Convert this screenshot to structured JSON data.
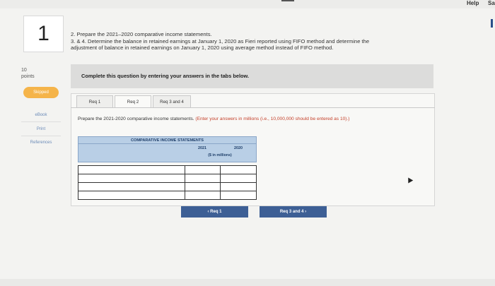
{
  "header": {
    "help": "Help",
    "save": "Sa"
  },
  "question": {
    "number": "1",
    "points_value": "10",
    "points_label": "points",
    "status": "Skipped"
  },
  "sidebar": {
    "links": [
      "eBook",
      "Print",
      "References"
    ]
  },
  "prompt": {
    "line1": "2. Prepare the 2021–2020 comparative income statements.",
    "line2": "3. & 4. Determine the balance in retained earnings at January 1, 2020 as Fieri reported using FIFO method and determine the",
    "line3": "adjustment of balance in retained earnings on January 1, 2020 using average method instead of FIFO method."
  },
  "banner": {
    "text": "Complete this question by entering your answers in the tabs below."
  },
  "tabs": [
    {
      "label": "Req 1"
    },
    {
      "label": "Req 2"
    },
    {
      "label": "Req 3 and 4"
    }
  ],
  "instruction": {
    "text": "Prepare the 2021-2020 comparative income statements.",
    "note": "(Enter your answers in millions (i.e., 10,000,000 should be entered as 10).)"
  },
  "table": {
    "title": "COMPARATIVE INCOME STATEMENTS",
    "col_2021": "2021",
    "col_2020": "2020",
    "unit": "($ in millions)",
    "rows": [
      [
        "",
        "",
        ""
      ],
      [
        "",
        "",
        ""
      ],
      [
        "",
        "",
        ""
      ],
      [
        "",
        "",
        ""
      ],
      [
        "",
        "",
        ""
      ]
    ]
  },
  "nav": {
    "prev": "‹  Req 1",
    "next": "Req 3 and 4  ›"
  },
  "colors": {
    "accent": "#3d5f95",
    "table_header": "#b9cfe6",
    "skipped": "#f5b44a"
  }
}
